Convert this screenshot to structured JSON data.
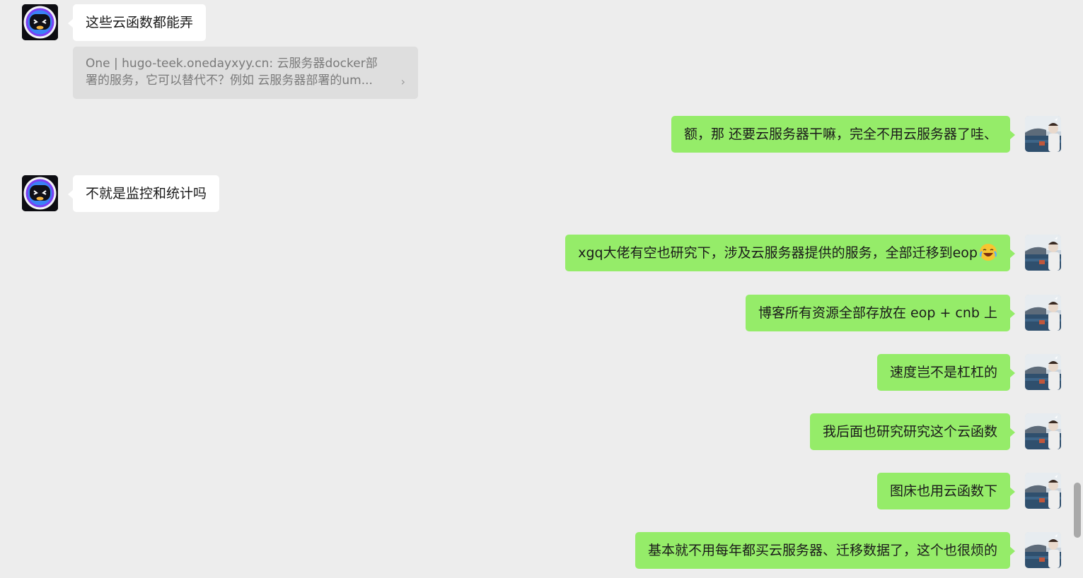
{
  "messages": {
    "m1": {
      "text": "这些云函数都能弄"
    },
    "quote": {
      "line1": "One | hugo-teek.onedayxyy.cn: 云服务器docker部",
      "line2": "署的服务，它可以替代不？例如  云服务器部署的um...",
      "chevron": "›"
    },
    "m2": {
      "text": "额，那 还要云服务器干嘛，完全不用云服务器了哇、"
    },
    "m3": {
      "text": "不就是监控和统计吗"
    },
    "m4": {
      "text": "xgq大佬有空也研究下，涉及云服务器提供的服务，全部迁移到eop",
      "emoji": "laugh-cry-emoji"
    },
    "m5": {
      "text": "博客所有资源全部存放在 eop + cnb 上"
    },
    "m6": {
      "text": "速度岂不是杠杠的"
    },
    "m7": {
      "text": "我后面也研究研究这个云函数"
    },
    "m8": {
      "text": "图床也用云函数下"
    },
    "m9": {
      "text": "基本就不用每年都买云服务器、迁移数据了，这个也很烦的"
    }
  },
  "colors": {
    "background": "#ededed",
    "bubble_self": "#95ec69",
    "bubble_other": "#ffffff",
    "quote_bg": "#dedede"
  }
}
